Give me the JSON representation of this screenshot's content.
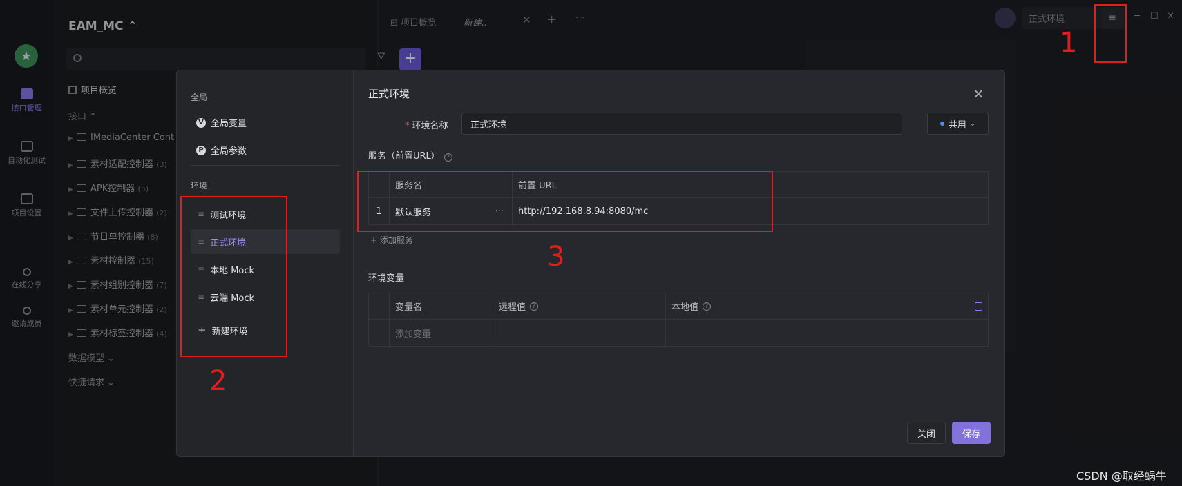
{
  "app": {
    "project_title": "EAM_MC ⌃",
    "rail": [
      {
        "label": "接口管理",
        "active": true
      },
      {
        "label": "自动化测试",
        "active": false
      },
      {
        "label": "项目设置",
        "active": false
      },
      {
        "label": "在线分享",
        "active": false
      },
      {
        "label": "邀请成员",
        "active": false
      }
    ],
    "sidebar": {
      "overview": "项目概览",
      "section_api": "接口 ⌃",
      "tree": [
        {
          "name": "IMediaCenter Cont",
          "count": ""
        },
        {
          "name": "素材适配控制器",
          "count": "(3)"
        },
        {
          "name": "APK控制器",
          "count": "(5)"
        },
        {
          "name": "文件上传控制器",
          "count": "(2)"
        },
        {
          "name": "节目单控制器",
          "count": "(8)"
        },
        {
          "name": "素材控制器",
          "count": "(15)"
        },
        {
          "name": "素材组别控制器",
          "count": "(7)"
        },
        {
          "name": "素材单元控制器",
          "count": "(2)"
        },
        {
          "name": "素材标签控制器",
          "count": "(4)"
        }
      ],
      "section_models": "数据模型 ⌄",
      "section_quick": "快捷请求 ⌄"
    },
    "topbar": {
      "tab_overview": "项目概览",
      "tab_new": "新建..",
      "current_env": "正式环境"
    }
  },
  "modal": {
    "left": {
      "global_title": "全局",
      "global_items": [
        {
          "badge": "V",
          "label": "全局变量"
        },
        {
          "badge": "P",
          "label": "全局参数"
        }
      ],
      "env_title": "环境",
      "environments": [
        {
          "label": "测试环境",
          "active": false
        },
        {
          "label": "正式环境",
          "active": true
        },
        {
          "label": "本地 Mock",
          "active": false
        },
        {
          "label": "云端 Mock",
          "active": false
        }
      ],
      "new_env": "新建环境"
    },
    "title": "正式环境",
    "env_name_label": "环境名称",
    "env_name_value": "正式环境",
    "share_label": "共用",
    "services_title": "服务（前置URL）",
    "services_table": {
      "headers": [
        "服务名",
        "前置 URL"
      ],
      "rows": [
        {
          "index": "1",
          "name": "默认服务",
          "more": "···",
          "url": "http://192.168.8.94:8080/mc"
        }
      ]
    },
    "add_service": "+ 添加服务",
    "envvars_title": "环境变量",
    "vars_table": {
      "headers": [
        "变量名",
        "远程值",
        "本地值"
      ],
      "add_placeholder": "添加变量"
    },
    "close_button": "关闭",
    "save_button": "保存"
  },
  "annotations": {
    "labels": [
      "1",
      "2",
      "3"
    ],
    "color": "#e11d1d"
  },
  "watermark": "CSDN @取经蜗牛",
  "colors": {
    "accent": "#8371dc",
    "active_text": "#9b8cf0",
    "modal_bg": "#26282d",
    "page_bg": "#1d1e22"
  }
}
